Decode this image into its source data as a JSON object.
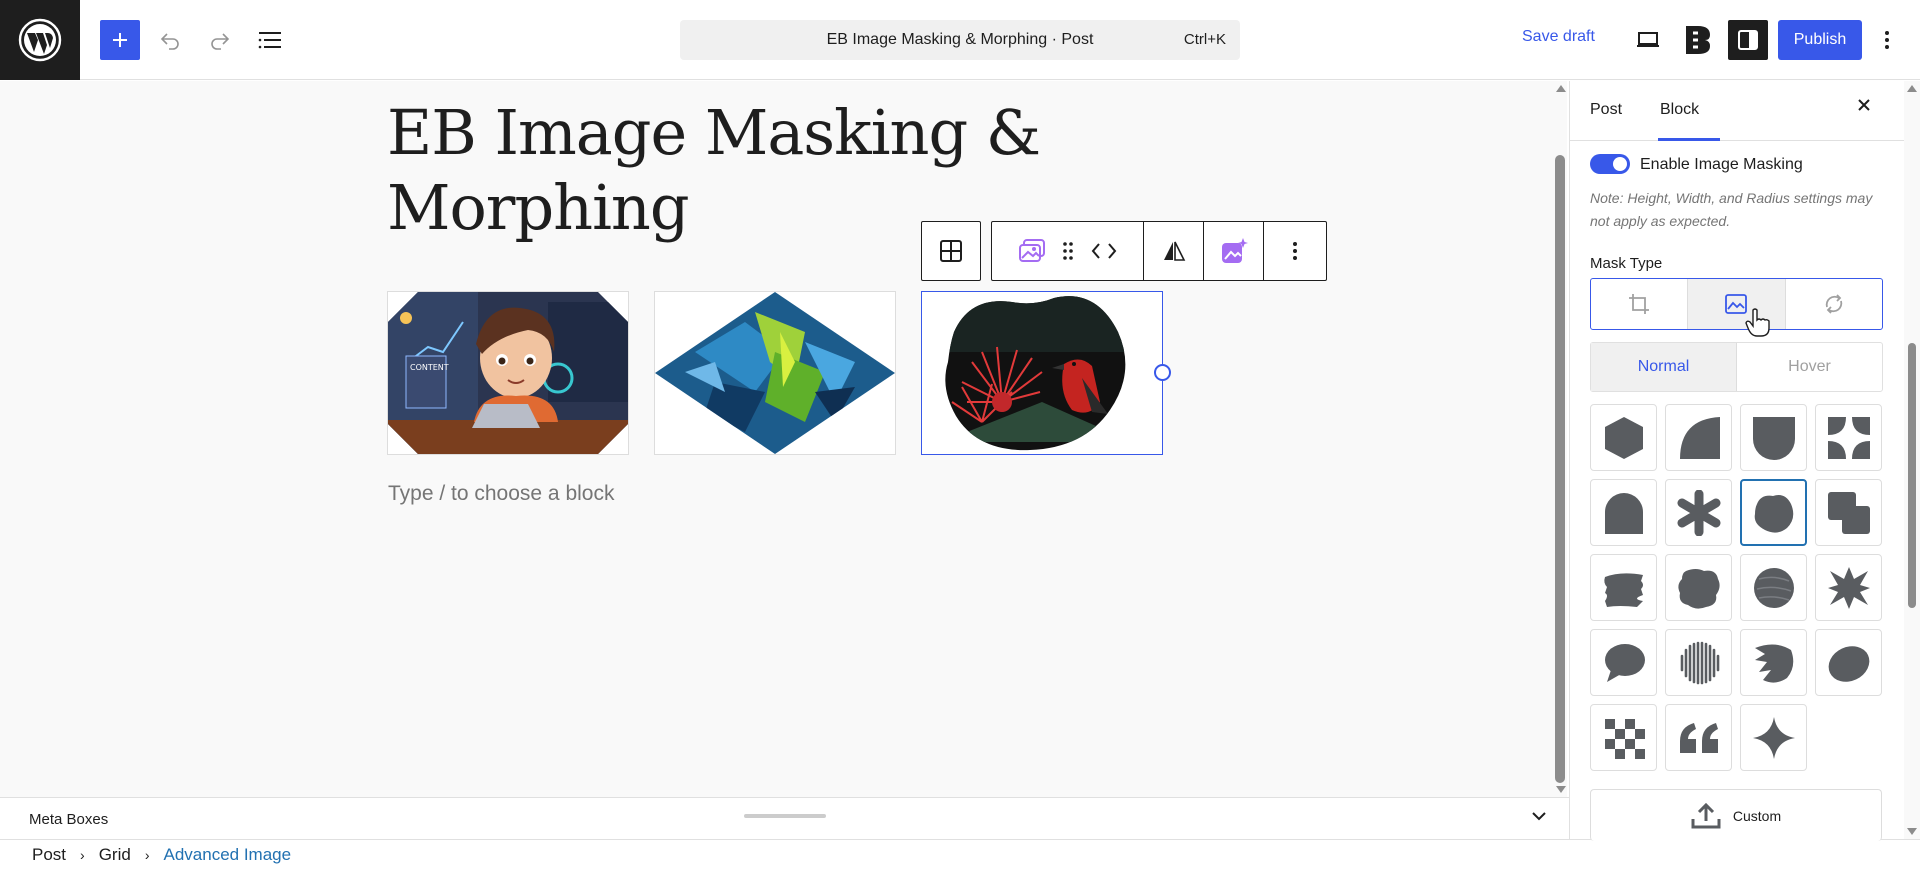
{
  "header": {
    "document_title": "EB Image Masking & Morphing · Post",
    "shortcut": "Ctrl+K",
    "save_draft": "Save draft",
    "publish": "Publish"
  },
  "post": {
    "title_line1": "EB Image Masking &",
    "title_line2": "Morphing",
    "placeholder": "Type / to choose a block"
  },
  "meta_boxes": {
    "label": "Meta Boxes"
  },
  "breadcrumbs": [
    "Post",
    "Grid",
    "Advanced Image"
  ],
  "sidebar": {
    "tabs": [
      "Post",
      "Block"
    ],
    "active_tab": "Block",
    "enable_masking_label": "Enable Image Masking",
    "enable_masking_on": true,
    "note": "Note: Height, Width, and Radius settings may not apply as expected.",
    "mask_type_label": "Mask Type",
    "mask_type_options": [
      "crop-icon",
      "image-icon",
      "morph-icon"
    ],
    "mask_type_selected": "image-icon",
    "state_tabs": [
      "Normal",
      "Hover"
    ],
    "state_selected": "Normal",
    "shapes": [
      "hexagon",
      "quarter-circle",
      "shield",
      "petals",
      "arch",
      "asterisk",
      "blob",
      "overlap-squares",
      "brush-stroke",
      "rough-blob",
      "scribble-circle",
      "starburst",
      "speech-bubble",
      "vertical-lines",
      "monstera-leaf",
      "ellipse",
      "checker",
      "quote-marks",
      "four-point-star"
    ],
    "shape_selected": "blob",
    "custom_label": "Custom"
  },
  "colors": {
    "accent": "#3858e9",
    "dark": "#1e1e1e",
    "link": "#2271b1",
    "shape_fill": "#595c60"
  }
}
